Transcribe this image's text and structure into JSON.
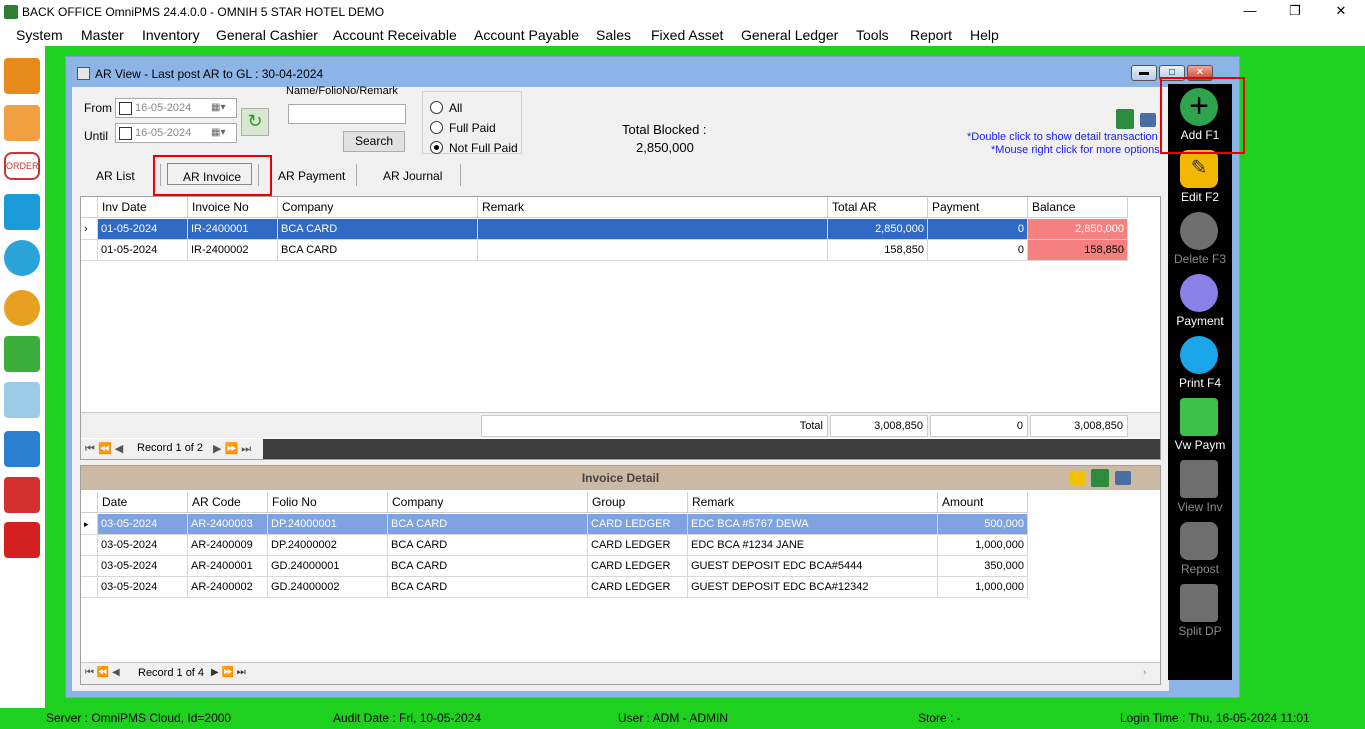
{
  "app": {
    "title": "BACK OFFICE OmniPMS 24.4.0.0 - OMNIH 5 STAR HOTEL DEMO",
    "minimize": "—",
    "maximize": "❐",
    "close": "✕"
  },
  "menu": [
    "System",
    "Master",
    "Inventory",
    "General Cashier",
    "Account Receivable",
    "Account Payable",
    "Sales",
    "Fixed Asset",
    "General Ledger",
    "Tools",
    "Report",
    "Help"
  ],
  "window": {
    "title": "AR View - Last post AR to GL : 30-04-2024"
  },
  "filter": {
    "from_label": "From",
    "from_value": "16-05-2024",
    "until_label": "Until",
    "until_value": "16-05-2024",
    "name_label": "Name/FolioNo/Remark",
    "name_value": "",
    "search_label": "Search",
    "radios": [
      "All",
      "Full Paid",
      "Not Full Paid"
    ],
    "selected_radio": "Not Full Paid",
    "total_blocked_label": "Total Blocked :",
    "total_blocked_value": "2,850,000",
    "hint1": "*Double click to show detail transaction",
    "hint2": "*Mouse right click for more options"
  },
  "tabs": [
    "AR List",
    "AR Invoice",
    "AR Payment",
    "AR Journal"
  ],
  "active_tab": "AR Invoice",
  "invoice_grid": {
    "columns": [
      "Inv Date",
      "Invoice No",
      "Company",
      "Remark",
      "Total AR",
      "Payment",
      "Balance"
    ],
    "rows": [
      [
        "01-05-2024",
        "IR-2400001",
        "BCA CARD",
        "",
        "2,850,000",
        "0",
        "2,850,000"
      ],
      [
        "01-05-2024",
        "IR-2400002",
        "BCA CARD",
        "",
        "158,850",
        "0",
        "158,850"
      ]
    ],
    "total_label": "Total",
    "totals": [
      "3,008,850",
      "0",
      "3,008,850"
    ],
    "record_text": "Record 1 of 2"
  },
  "detail": {
    "title": "Invoice Detail",
    "columns": [
      "Date",
      "AR Code",
      "Folio No",
      "Company",
      "Group",
      "Remark",
      "Amount"
    ],
    "rows": [
      [
        "03-05-2024",
        "AR-2400003",
        "DP.24000001",
        "BCA CARD",
        "CARD LEDGER",
        "EDC BCA  #5767 DEWA",
        "500,000"
      ],
      [
        "03-05-2024",
        "AR-2400009",
        "DP.24000002",
        "BCA CARD",
        "CARD LEDGER",
        "EDC BCA  #1234 JANE",
        "1,000,000"
      ],
      [
        "03-05-2024",
        "AR-2400001",
        "GD.24000001",
        "BCA CARD",
        "CARD LEDGER",
        "GUEST DEPOSIT EDC BCA#5444",
        "350,000"
      ],
      [
        "03-05-2024",
        "AR-2400002",
        "GD.24000002",
        "BCA CARD",
        "CARD LEDGER",
        "GUEST DEPOSIT EDC BCA#12342",
        "1,000,000"
      ]
    ],
    "record_text": "Record 1 of 4"
  },
  "actions": [
    {
      "label": "Add F1",
      "icon": "add-icon",
      "color": "#2ea44f",
      "enabled": true
    },
    {
      "label": "Edit F2",
      "icon": "edit-icon",
      "color": "#f2b705",
      "enabled": true
    },
    {
      "label": "Delete F3",
      "icon": "delete-icon",
      "color": "#6e6e6e",
      "enabled": false
    },
    {
      "label": "Payment",
      "icon": "payment-icon",
      "color": "#8b7fe8",
      "enabled": true
    },
    {
      "label": "Print F4",
      "icon": "print-icon",
      "color": "#1aa6e8",
      "enabled": true
    },
    {
      "label": "Vw Paym",
      "icon": "view-payment-icon",
      "color": "#3cc24a",
      "enabled": true
    },
    {
      "label": "View Inv",
      "icon": "view-invoice-icon",
      "color": "#6e6e6e",
      "enabled": false
    },
    {
      "label": "Repost",
      "icon": "post-icon",
      "color": "#6e6e6e",
      "enabled": false
    },
    {
      "label": "Split DP",
      "icon": "split-icon",
      "color": "#6e6e6e",
      "enabled": false
    }
  ],
  "status": {
    "server": "Server : OmniPMS Cloud, Id=2000",
    "audit": "Audit Date : Fri, 10-05-2024",
    "user": "User : ADM - ADMIN",
    "store": "Store :  -",
    "login": "Login Time : Thu, 16-05-2024 11:01"
  }
}
